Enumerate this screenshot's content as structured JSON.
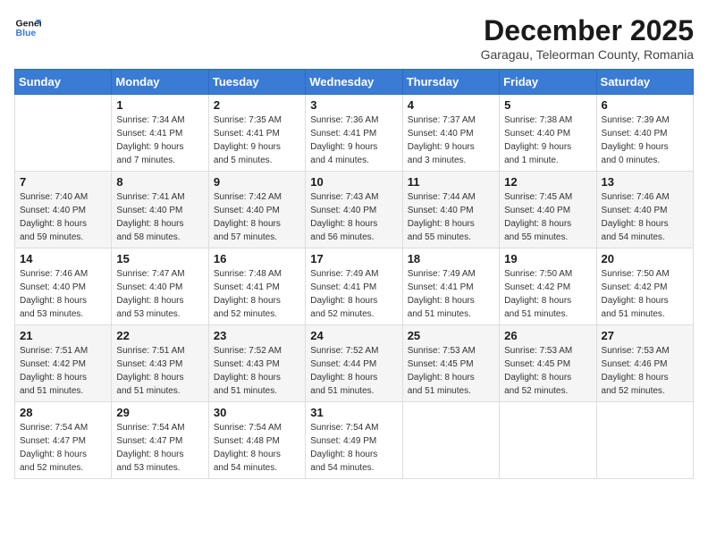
{
  "logo": {
    "line1": "General",
    "line2": "Blue"
  },
  "title": "December 2025",
  "subtitle": "Garagau, Teleorman County, Romania",
  "weekdays": [
    "Sunday",
    "Monday",
    "Tuesday",
    "Wednesday",
    "Thursday",
    "Friday",
    "Saturday"
  ],
  "weeks": [
    [
      {
        "day": "",
        "info": ""
      },
      {
        "day": "1",
        "info": "Sunrise: 7:34 AM\nSunset: 4:41 PM\nDaylight: 9 hours\nand 7 minutes."
      },
      {
        "day": "2",
        "info": "Sunrise: 7:35 AM\nSunset: 4:41 PM\nDaylight: 9 hours\nand 5 minutes."
      },
      {
        "day": "3",
        "info": "Sunrise: 7:36 AM\nSunset: 4:41 PM\nDaylight: 9 hours\nand 4 minutes."
      },
      {
        "day": "4",
        "info": "Sunrise: 7:37 AM\nSunset: 4:40 PM\nDaylight: 9 hours\nand 3 minutes."
      },
      {
        "day": "5",
        "info": "Sunrise: 7:38 AM\nSunset: 4:40 PM\nDaylight: 9 hours\nand 1 minute."
      },
      {
        "day": "6",
        "info": "Sunrise: 7:39 AM\nSunset: 4:40 PM\nDaylight: 9 hours\nand 0 minutes."
      }
    ],
    [
      {
        "day": "7",
        "info": "Sunrise: 7:40 AM\nSunset: 4:40 PM\nDaylight: 8 hours\nand 59 minutes."
      },
      {
        "day": "8",
        "info": "Sunrise: 7:41 AM\nSunset: 4:40 PM\nDaylight: 8 hours\nand 58 minutes."
      },
      {
        "day": "9",
        "info": "Sunrise: 7:42 AM\nSunset: 4:40 PM\nDaylight: 8 hours\nand 57 minutes."
      },
      {
        "day": "10",
        "info": "Sunrise: 7:43 AM\nSunset: 4:40 PM\nDaylight: 8 hours\nand 56 minutes."
      },
      {
        "day": "11",
        "info": "Sunrise: 7:44 AM\nSunset: 4:40 PM\nDaylight: 8 hours\nand 55 minutes."
      },
      {
        "day": "12",
        "info": "Sunrise: 7:45 AM\nSunset: 4:40 PM\nDaylight: 8 hours\nand 55 minutes."
      },
      {
        "day": "13",
        "info": "Sunrise: 7:46 AM\nSunset: 4:40 PM\nDaylight: 8 hours\nand 54 minutes."
      }
    ],
    [
      {
        "day": "14",
        "info": "Sunrise: 7:46 AM\nSunset: 4:40 PM\nDaylight: 8 hours\nand 53 minutes."
      },
      {
        "day": "15",
        "info": "Sunrise: 7:47 AM\nSunset: 4:40 PM\nDaylight: 8 hours\nand 53 minutes."
      },
      {
        "day": "16",
        "info": "Sunrise: 7:48 AM\nSunset: 4:41 PM\nDaylight: 8 hours\nand 52 minutes."
      },
      {
        "day": "17",
        "info": "Sunrise: 7:49 AM\nSunset: 4:41 PM\nDaylight: 8 hours\nand 52 minutes."
      },
      {
        "day": "18",
        "info": "Sunrise: 7:49 AM\nSunset: 4:41 PM\nDaylight: 8 hours\nand 51 minutes."
      },
      {
        "day": "19",
        "info": "Sunrise: 7:50 AM\nSunset: 4:42 PM\nDaylight: 8 hours\nand 51 minutes."
      },
      {
        "day": "20",
        "info": "Sunrise: 7:50 AM\nSunset: 4:42 PM\nDaylight: 8 hours\nand 51 minutes."
      }
    ],
    [
      {
        "day": "21",
        "info": "Sunrise: 7:51 AM\nSunset: 4:42 PM\nDaylight: 8 hours\nand 51 minutes."
      },
      {
        "day": "22",
        "info": "Sunrise: 7:51 AM\nSunset: 4:43 PM\nDaylight: 8 hours\nand 51 minutes."
      },
      {
        "day": "23",
        "info": "Sunrise: 7:52 AM\nSunset: 4:43 PM\nDaylight: 8 hours\nand 51 minutes."
      },
      {
        "day": "24",
        "info": "Sunrise: 7:52 AM\nSunset: 4:44 PM\nDaylight: 8 hours\nand 51 minutes."
      },
      {
        "day": "25",
        "info": "Sunrise: 7:53 AM\nSunset: 4:45 PM\nDaylight: 8 hours\nand 51 minutes."
      },
      {
        "day": "26",
        "info": "Sunrise: 7:53 AM\nSunset: 4:45 PM\nDaylight: 8 hours\nand 52 minutes."
      },
      {
        "day": "27",
        "info": "Sunrise: 7:53 AM\nSunset: 4:46 PM\nDaylight: 8 hours\nand 52 minutes."
      }
    ],
    [
      {
        "day": "28",
        "info": "Sunrise: 7:54 AM\nSunset: 4:47 PM\nDaylight: 8 hours\nand 52 minutes."
      },
      {
        "day": "29",
        "info": "Sunrise: 7:54 AM\nSunset: 4:47 PM\nDaylight: 8 hours\nand 53 minutes."
      },
      {
        "day": "30",
        "info": "Sunrise: 7:54 AM\nSunset: 4:48 PM\nDaylight: 8 hours\nand 54 minutes."
      },
      {
        "day": "31",
        "info": "Sunrise: 7:54 AM\nSunset: 4:49 PM\nDaylight: 8 hours\nand 54 minutes."
      },
      {
        "day": "",
        "info": ""
      },
      {
        "day": "",
        "info": ""
      },
      {
        "day": "",
        "info": ""
      }
    ]
  ]
}
